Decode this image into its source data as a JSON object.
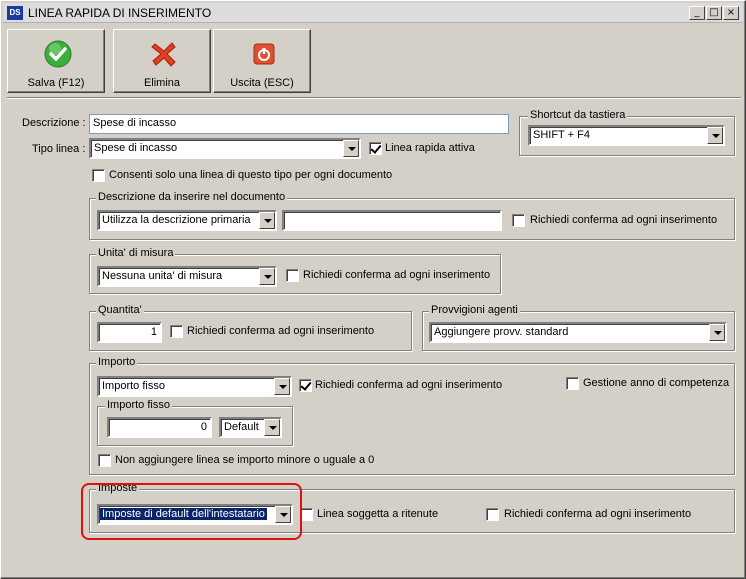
{
  "window": {
    "title": "LINEA RAPIDA DI INSERIMENTO",
    "app_icon_text": "DS",
    "controls": {
      "minimize": "_",
      "maximize": "□",
      "close": "×"
    }
  },
  "toolbar": {
    "save_label": "Salva (F12)",
    "delete_label": "Elimina",
    "exit_label": "Uscita (ESC)"
  },
  "form": {
    "descrizione_label": "Descrizione :",
    "descrizione_value": "Spese di incasso",
    "tipo_linea_label": "Tipo linea :",
    "tipo_linea_value": "Spese di incasso",
    "linea_attiva_label": "Linea rapida attiva",
    "linea_attiva_checked": true,
    "consenti_label": "Consenti solo una linea di questo tipo per ogni documento",
    "consenti_checked": false
  },
  "shortcut": {
    "title": "Shortcut da tastiera",
    "value": "SHIFT + F4"
  },
  "descrizione_doc": {
    "title": "Descrizione da inserire nel documento",
    "select_value": "Utilizza la descrizione primaria",
    "text_value": "",
    "confirm_label": "Richiedi conferma ad ogni inserimento",
    "confirm_checked": false
  },
  "unita": {
    "title": "Unita' di misura",
    "select_value": "Nessuna unita' di misura",
    "confirm_label": "Richiedi conferma ad ogni inserimento",
    "confirm_checked": false
  },
  "quantita": {
    "title": "Quantita'",
    "value": "1",
    "confirm_label": "Richiedi conferma ad ogni inserimento",
    "confirm_checked": false
  },
  "provvigioni": {
    "title": "Provvigioni agenti",
    "select_value": "Aggiungere provv. standard"
  },
  "importo": {
    "title": "Importo",
    "select_value": "Importo fisso",
    "confirm_label": "Richiedi conferma ad ogni inserimento",
    "confirm_checked": true,
    "gestione_label": "Gestione anno di competenza",
    "gestione_checked": false,
    "fisso_title": "Importo fisso",
    "fisso_value": "0",
    "fisso_mode": "Default",
    "non_aggiungere_label": "Non aggiungere linea se importo minore o uguale a 0",
    "non_aggiungere_checked": false
  },
  "imposte": {
    "title": "Imposte",
    "select_value": "Imposte di default dell'intestatario",
    "ritenute_label": "Linea soggetta a ritenute",
    "ritenute_checked": false,
    "confirm_label": "Richiedi conferma ad ogni inserimento",
    "confirm_checked": false
  },
  "colors": {
    "window_bg": "#d4d0c8",
    "selection": "#0a246a",
    "highlight_border": "#e01010",
    "save_icon": "#3cae3c",
    "delete_icon": "#e04020",
    "exit_icon": "#e05030"
  }
}
